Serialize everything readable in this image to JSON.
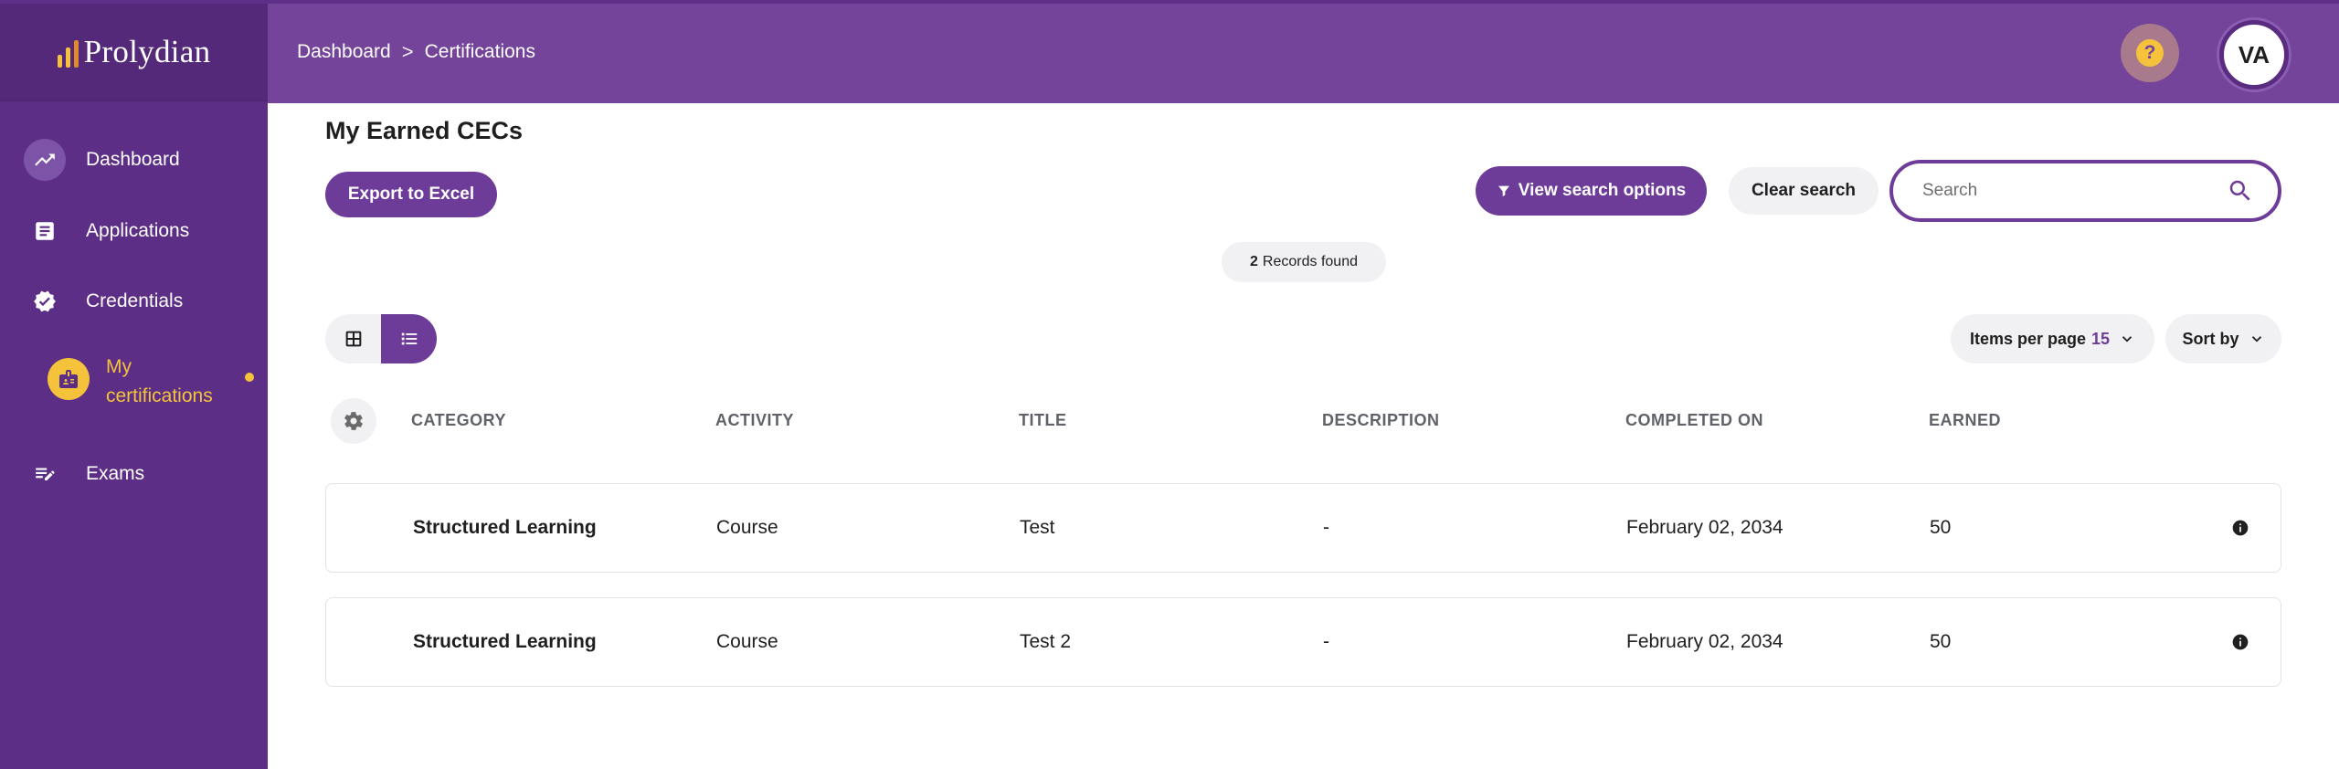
{
  "app": {
    "logo_text": "Prolydian"
  },
  "colors": {
    "brand_purple": "#74449b",
    "sidebar_purple": "#5c2e85",
    "accent_yellow": "#f5c33b",
    "button_purple": "#6d3b98"
  },
  "sidebar": {
    "items": [
      {
        "label": "Dashboard",
        "icon": "trending-up-icon",
        "active": true
      },
      {
        "label": "Applications",
        "icon": "document-icon"
      },
      {
        "label": "Credentials",
        "icon": "verified-badge-icon"
      },
      {
        "label": "Exams",
        "icon": "edit-list-icon"
      }
    ],
    "sub_item": {
      "label_line1": "My",
      "label_line2": "certifications",
      "icon": "badge-icon"
    }
  },
  "header": {
    "breadcrumb": [
      "Dashboard",
      "Certifications"
    ],
    "breadcrumb_separator": ">",
    "help_label": "?",
    "avatar_initials": "VA"
  },
  "main": {
    "title": "My Earned CECs",
    "export_label": "Export to Excel",
    "view_search_label": "View search options",
    "clear_search_label": "Clear search",
    "search_placeholder": "Search",
    "records_count": "2",
    "records_label": "Records found",
    "items_per_page_label": "Items per page",
    "items_per_page_value": "15",
    "sort_by_label": "Sort by"
  },
  "table": {
    "columns": [
      "CATEGORY",
      "ACTIVITY",
      "TITLE",
      "DESCRIPTION",
      "COMPLETED ON",
      "EARNED"
    ],
    "rows": [
      {
        "category": "Structured Learning",
        "activity": "Course",
        "title": "Test",
        "description": "-",
        "completed_on": "February 02, 2034",
        "earned": "50"
      },
      {
        "category": "Structured Learning",
        "activity": "Course",
        "title": "Test 2",
        "description": "-",
        "completed_on": "February 02, 2034",
        "earned": "50"
      }
    ]
  }
}
